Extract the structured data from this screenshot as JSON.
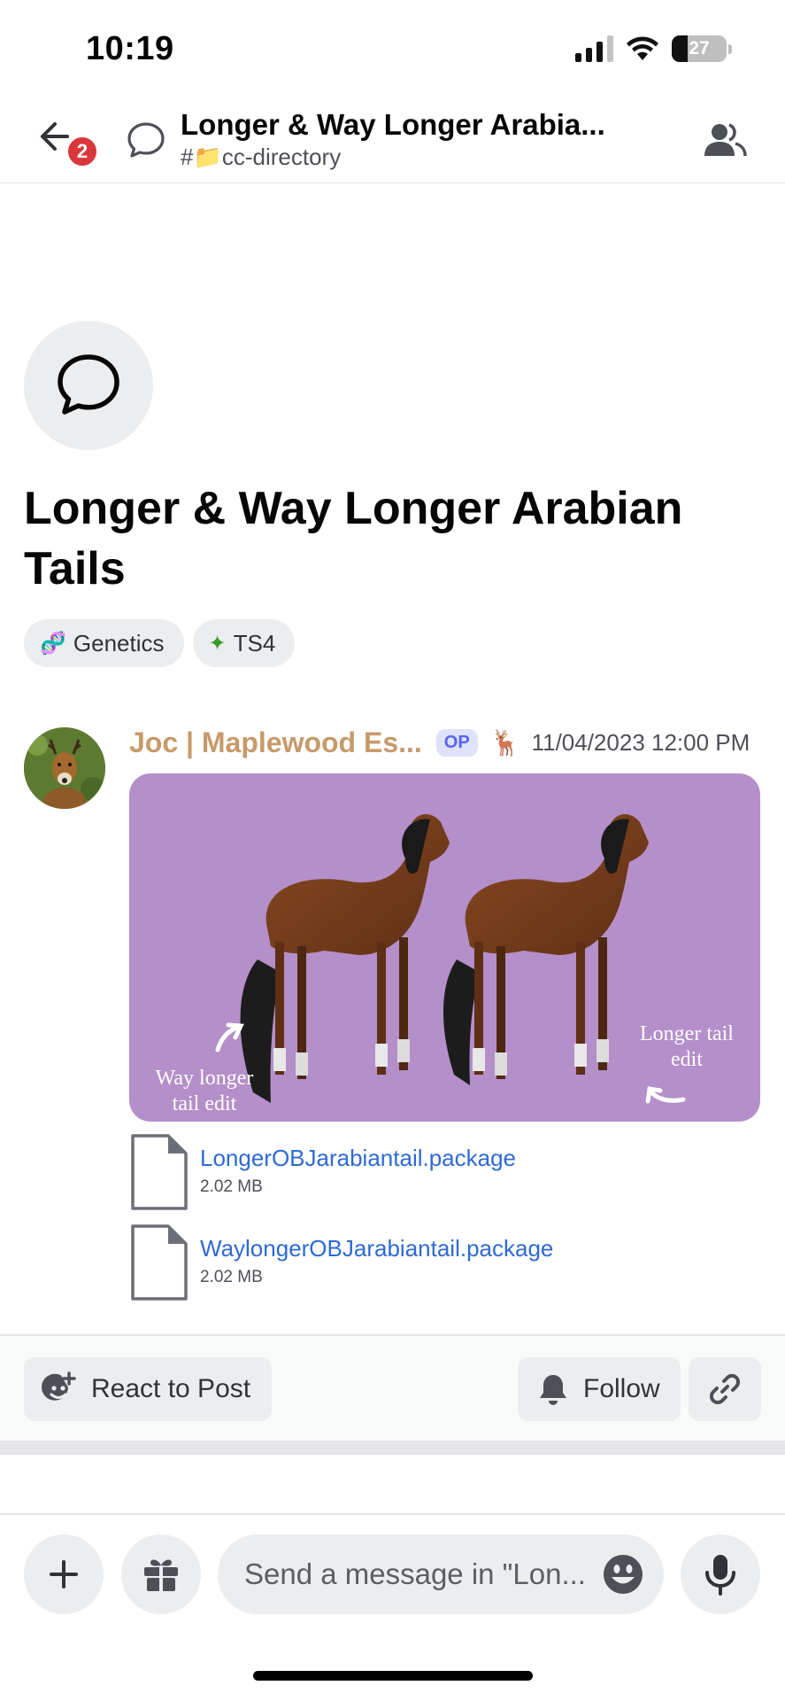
{
  "status_bar": {
    "time": "10:19",
    "battery": "27"
  },
  "header": {
    "back_badge": "2",
    "title": "Longer & Way Longer Arabia...",
    "channel": "#📁cc-directory"
  },
  "thread": {
    "title": "Longer & Way Longer Arabian Tails",
    "tags": [
      {
        "emoji": "🧬",
        "label": "Genetics"
      },
      {
        "emoji": "✦",
        "label": "TS4"
      }
    ]
  },
  "message": {
    "author": "Joc | Maplewood Es...",
    "op_badge": "OP",
    "role_emoji": "🦌",
    "timestamp": "11/04/2023 12:00 PM",
    "image_labels": {
      "left": "Way longer tail edit",
      "right": "Longer tail edit"
    },
    "attachments": [
      {
        "name": "LongerOBJarabiantail.package",
        "size": "2.02 MB"
      },
      {
        "name": "WaylongerOBJarabiantail.package",
        "size": "2.02 MB"
      }
    ]
  },
  "actions": {
    "react": "React to Post",
    "follow": "Follow"
  },
  "composer": {
    "placeholder": "Send a message in \"Lon..."
  },
  "colors": {
    "author": "#c79a6b",
    "link": "#2e6ad4",
    "image_bg": "#b48fc9",
    "badge_red": "#da373c"
  }
}
